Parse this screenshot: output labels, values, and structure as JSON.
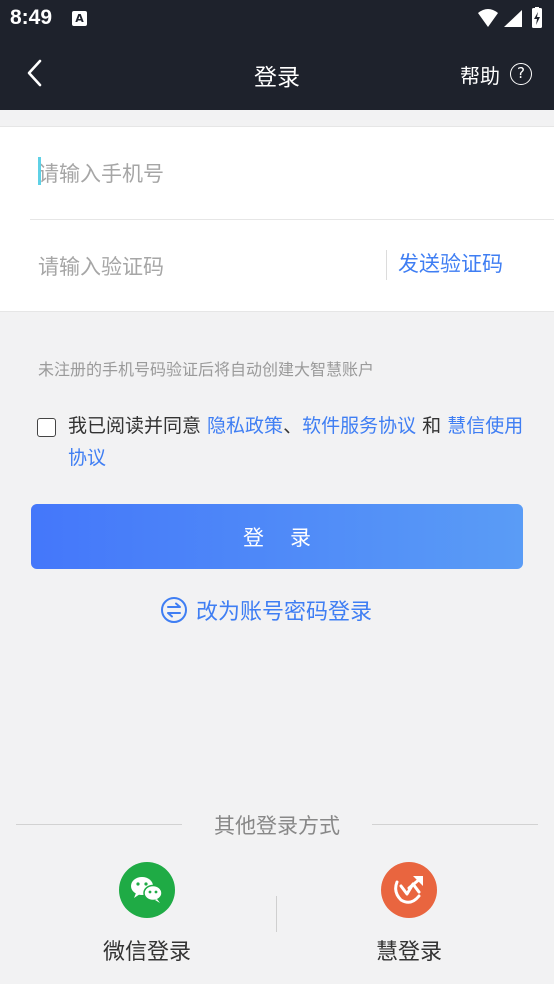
{
  "status_bar": {
    "time": "8:49",
    "notification_glyph": "A"
  },
  "nav": {
    "title": "登录",
    "help_label": "帮助",
    "help_icon_glyph": "?"
  },
  "form": {
    "phone_placeholder": "请输入手机号",
    "code_placeholder": "请输入验证码",
    "send_code_label": "发送验证码"
  },
  "hint": "未注册的手机号码验证后将自动创建大智慧账户",
  "agreement": {
    "prefix": "我已阅读并同意 ",
    "privacy_policy": "隐私政策",
    "separator": "、",
    "service_agreement": "软件服务协议",
    "and": " 和 ",
    "hui_agreement": "慧信使用协议"
  },
  "login_button_label": "登录",
  "switch_login_label": "改为账号密码登录",
  "other_login": {
    "title": "其他登录方式",
    "options": [
      {
        "label": "微信登录",
        "icon": "wechat-icon",
        "color": "#1fab45"
      },
      {
        "label": "慧登录",
        "icon": "hui-logo-icon",
        "color": "#e9653f"
      }
    ]
  },
  "colors": {
    "header_bg": "#1e222c",
    "accent": "#3f7ef3",
    "button_gradient_start": "#4477fa",
    "button_gradient_end": "#5a9cf6"
  }
}
